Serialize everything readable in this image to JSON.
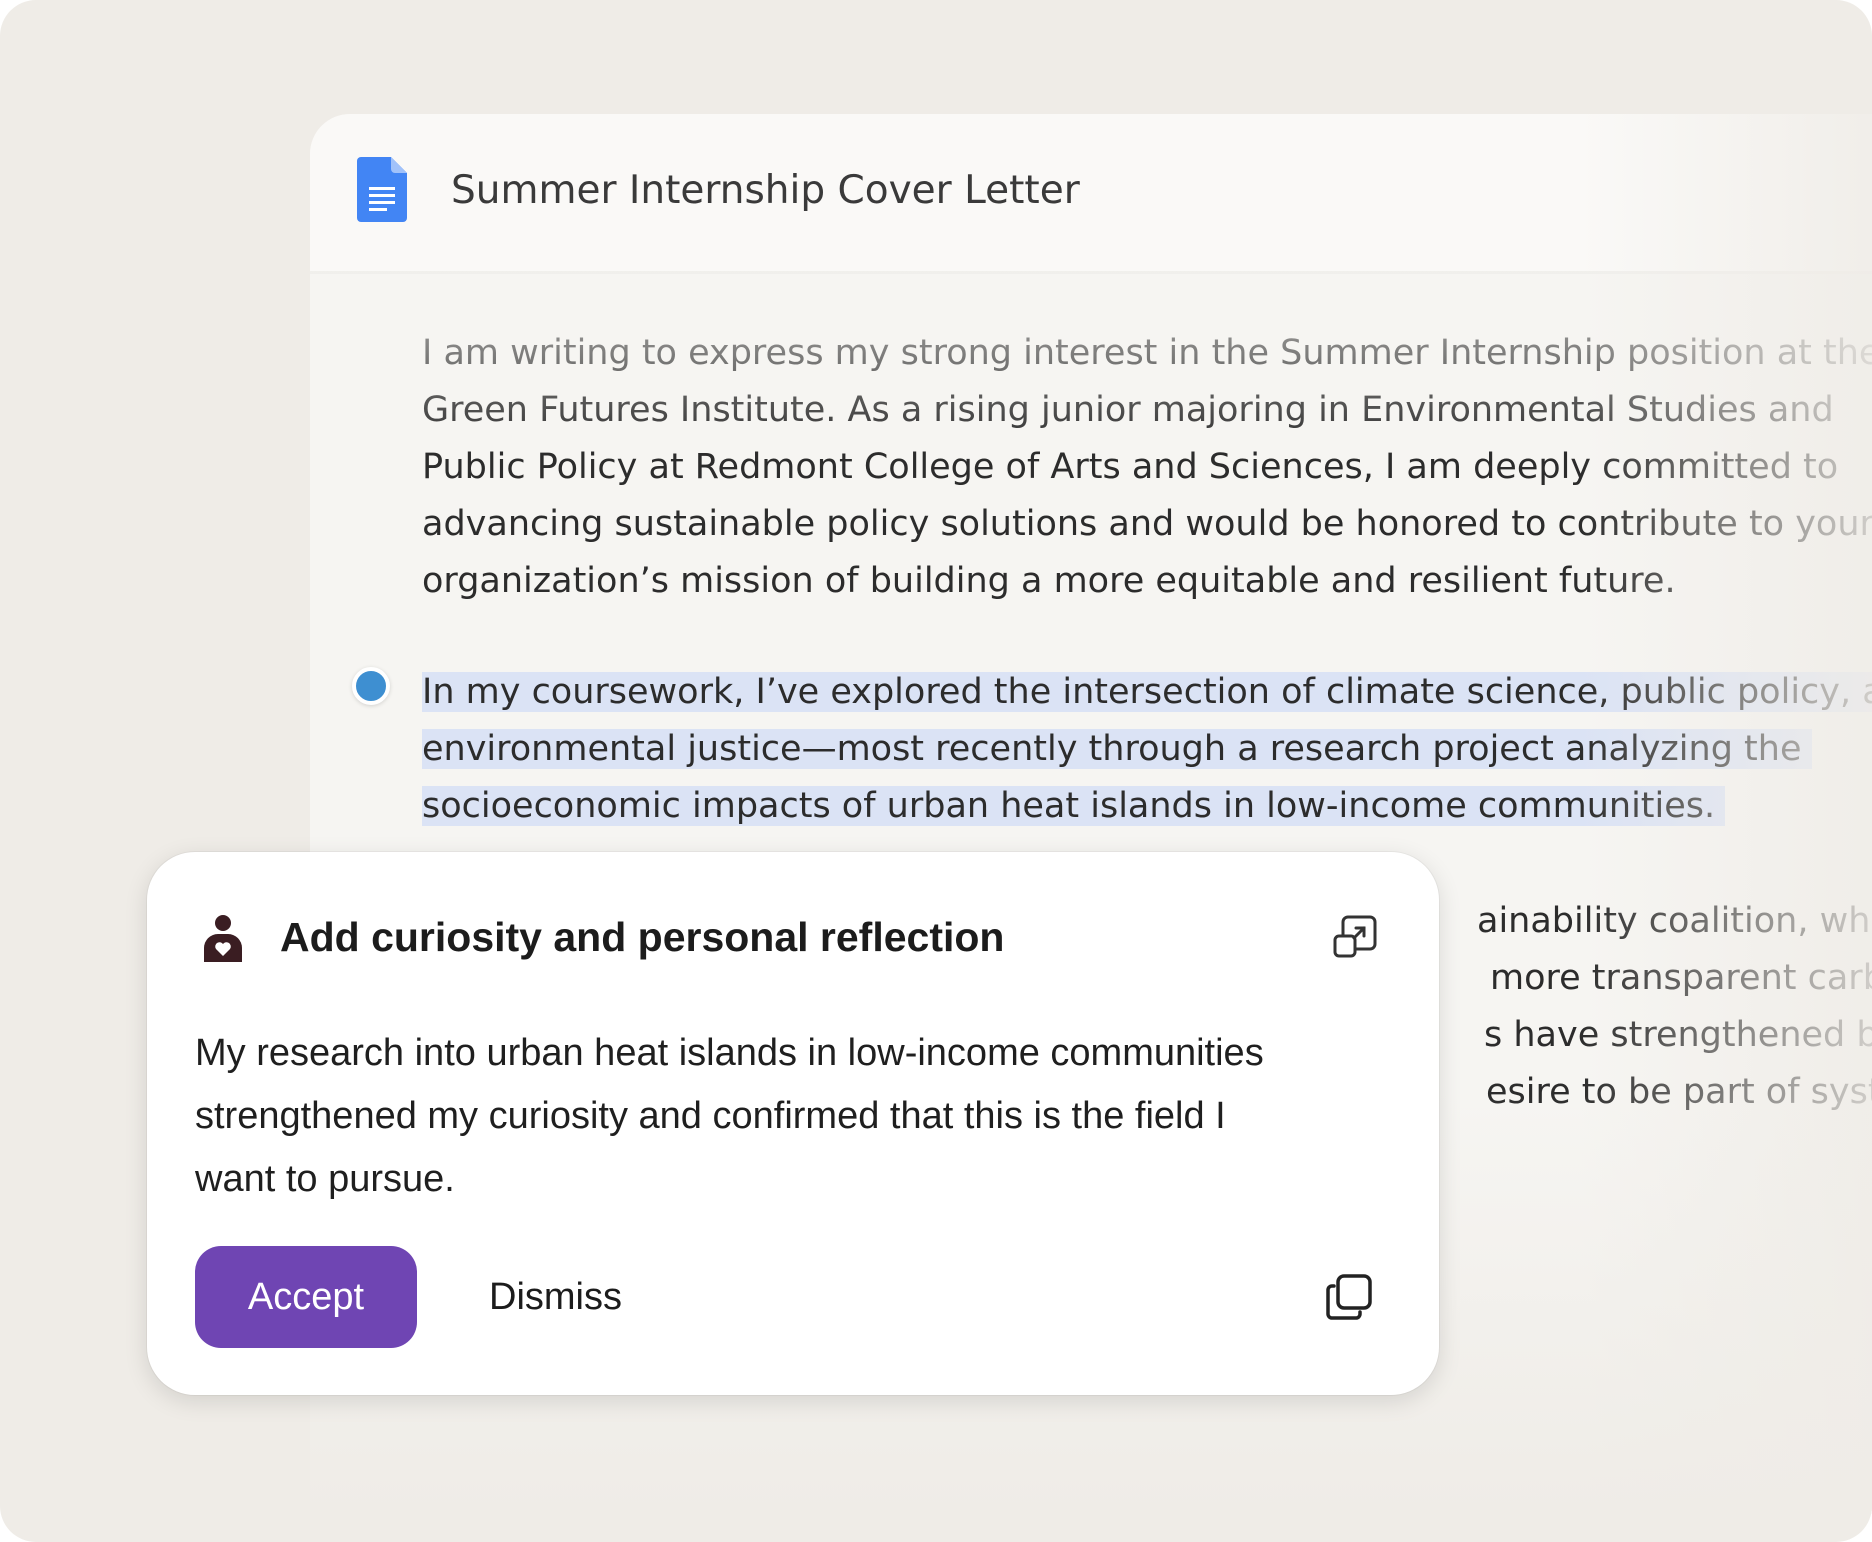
{
  "document": {
    "title": "Summer Internship Cover Letter",
    "icon": "google-docs-icon",
    "paragraphs": [
      {
        "lines": [
          "I am writing to express my strong interest in the Summer Internship position at the",
          "Green Futures Institute. As a rising junior majoring in Environmental Studies and",
          "Public Policy at Redmont College of Arts and Sciences, I am deeply committed to",
          "advancing sustainable policy solutions and would be honored to contribute to your",
          "organization’s mission of building a more equitable and resilient future."
        ]
      },
      {
        "highlighted": true,
        "lines": [
          "In my coursework, I’ve explored the intersection of climate science, public policy, and",
          "environmental justice—most recently through a research project analyzing the",
          "socioeconomic impacts of urban heat islands in low-income communities."
        ]
      },
      {
        "lines_visible_fragments": [
          "ainability coalition, wher",
          "more transparent carbo",
          "s have strengthened bot",
          "esire to be part of syster"
        ]
      }
    ]
  },
  "suggestion": {
    "icon": "person-heart-icon",
    "title": "Add curiosity and personal reflection",
    "text_lines": [
      "My research into urban heat islands in low-income communities",
      "strengthened my curiosity and confirmed that this is the field I",
      "want to pursue."
    ],
    "accept_label": "Accept",
    "dismiss_label": "Dismiss",
    "expand_icon": "expand-icon",
    "copy_icon": "copy-icon"
  },
  "colors": {
    "background": "#efece7",
    "highlight": "#dbe3f5",
    "accent": "#6f45b3",
    "marker": "#3e8fd1",
    "docs_blue": "#4285f4"
  }
}
